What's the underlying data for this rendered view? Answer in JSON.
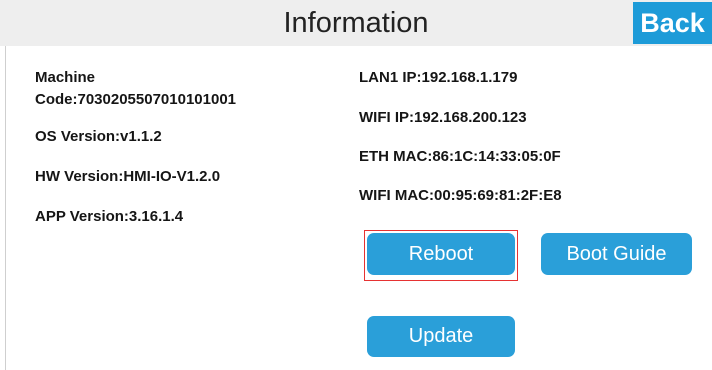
{
  "header": {
    "title": "Information",
    "back_label": "Back"
  },
  "device_info": {
    "machine_code_label": "Machine",
    "machine_code_value": "Code:7030205507010101001",
    "os_version": "OS Version:v1.1.2",
    "hw_version": "HW Version:HMI-IO-V1.2.0",
    "app_version": "APP Version:3.16.1.4"
  },
  "network_info": {
    "lan1_ip": "LAN1 IP:192.168.1.179",
    "wifi_ip": "WIFI IP:192.168.200.123",
    "eth_mac": "ETH MAC:86:1C:14:33:05:0F",
    "wifi_mac": "WIFI MAC:00:95:69:81:2F:E8"
  },
  "actions": {
    "reboot_label": "Reboot",
    "boot_guide_label": "Boot Guide",
    "update_label": "Update"
  },
  "colors": {
    "accent": "#2a9fd9",
    "highlight": "#e63232"
  }
}
